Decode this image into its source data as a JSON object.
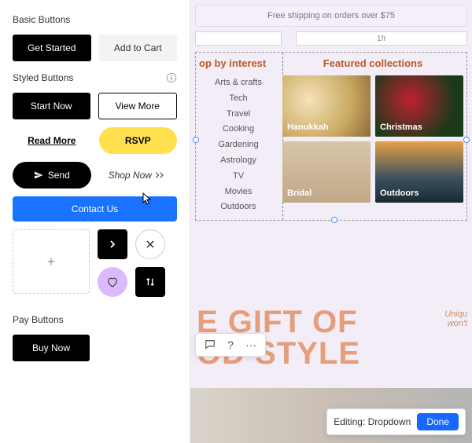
{
  "panel": {
    "basic_title": "Basic Buttons",
    "basic": {
      "get_started": "Get Started",
      "add_to_cart": "Add to Cart"
    },
    "styled_title": "Styled Buttons",
    "styled": {
      "start_now": "Start Now",
      "view_more": "View More",
      "read_more": "Read More",
      "rsvp": "RSVP",
      "send": "Send",
      "shop_now": "Shop Now",
      "contact_us": "Contact Us"
    },
    "pay_title": "Pay Buttons",
    "pay": {
      "buy_now": "Buy Now"
    }
  },
  "canvas": {
    "banner": "Free shipping on orders over $75",
    "ruler_unit": "1fr",
    "interest_title": "op by interest",
    "interests": [
      "Arts & crafts",
      "Tech",
      "Travel",
      "Cooking",
      "Gardening",
      "Astrology",
      "TV",
      "Movies",
      "Outdoors"
    ],
    "featured_title": "Featured collections",
    "tiles": {
      "hanukkah": "Hanukkah",
      "christmas": "Christmas",
      "bridal": "Bridal",
      "outdoors": "Outdoors"
    },
    "headline_1": "E GIFT OF",
    "headline_2": "OD STYLE",
    "blurb_1": "Uniqu",
    "blurb_2": "won't"
  },
  "status": {
    "label": "Editing: Dropdown",
    "done": "Done"
  }
}
